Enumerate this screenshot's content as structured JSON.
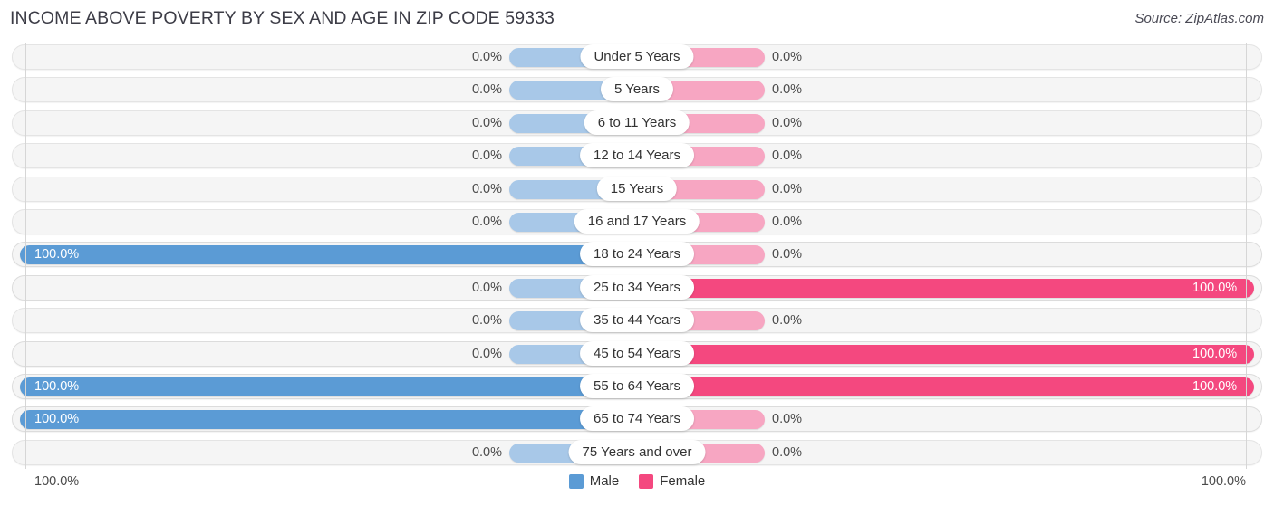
{
  "header": {
    "title": "INCOME ABOVE POVERTY BY SEX AND AGE IN ZIP CODE 59333",
    "source": "Source: ZipAtlas.com"
  },
  "legend": {
    "male_label": "Male",
    "female_label": "Female",
    "male_color": "#5b9bd5",
    "female_color": "#f4487f"
  },
  "axis": {
    "left_label": "100.0%",
    "right_label": "100.0%"
  },
  "chart_data": {
    "type": "bar",
    "title": "INCOME ABOVE POVERTY BY SEX AND AGE IN ZIP CODE 59333",
    "subtitle": "Source: ZipAtlas.com",
    "orientation": "horizontal-diverging",
    "xlabel": "",
    "ylabel": "",
    "xlim": [
      0,
      100
    ],
    "grid": false,
    "legend_position": "bottom-center",
    "categories": [
      "Under 5 Years",
      "5 Years",
      "6 to 11 Years",
      "12 to 14 Years",
      "15 Years",
      "16 and 17 Years",
      "18 to 24 Years",
      "25 to 34 Years",
      "35 to 44 Years",
      "45 to 54 Years",
      "55 to 64 Years",
      "65 to 74 Years",
      "75 Years and over"
    ],
    "series": [
      {
        "name": "Male",
        "color": "#5b9bd5",
        "values": [
          0.0,
          0.0,
          0.0,
          0.0,
          0.0,
          0.0,
          100.0,
          0.0,
          0.0,
          0.0,
          100.0,
          100.0,
          0.0
        ],
        "labels": [
          "0.0%",
          "0.0%",
          "0.0%",
          "0.0%",
          "0.0%",
          "0.0%",
          "100.0%",
          "0.0%",
          "0.0%",
          "0.0%",
          "100.0%",
          "100.0%",
          "0.0%"
        ]
      },
      {
        "name": "Female",
        "color": "#f4487f",
        "values": [
          0.0,
          0.0,
          0.0,
          0.0,
          0.0,
          0.0,
          0.0,
          100.0,
          0.0,
          100.0,
          100.0,
          0.0,
          0.0
        ],
        "labels": [
          "0.0%",
          "0.0%",
          "0.0%",
          "0.0%",
          "0.0%",
          "0.0%",
          "0.0%",
          "100.0%",
          "0.0%",
          "100.0%",
          "100.0%",
          "0.0%",
          "0.0%"
        ]
      }
    ]
  },
  "rows": [
    {
      "label": "Under 5 Years",
      "male": 0.0,
      "male_label": "0.0%",
      "female": 0.0,
      "female_label": "0.0%"
    },
    {
      "label": "5 Years",
      "male": 0.0,
      "male_label": "0.0%",
      "female": 0.0,
      "female_label": "0.0%"
    },
    {
      "label": "6 to 11 Years",
      "male": 0.0,
      "male_label": "0.0%",
      "female": 0.0,
      "female_label": "0.0%"
    },
    {
      "label": "12 to 14 Years",
      "male": 0.0,
      "male_label": "0.0%",
      "female": 0.0,
      "female_label": "0.0%"
    },
    {
      "label": "15 Years",
      "male": 0.0,
      "male_label": "0.0%",
      "female": 0.0,
      "female_label": "0.0%"
    },
    {
      "label": "16 and 17 Years",
      "male": 0.0,
      "male_label": "0.0%",
      "female": 0.0,
      "female_label": "0.0%"
    },
    {
      "label": "18 to 24 Years",
      "male": 100.0,
      "male_label": "100.0%",
      "female": 0.0,
      "female_label": "0.0%"
    },
    {
      "label": "25 to 34 Years",
      "male": 0.0,
      "male_label": "0.0%",
      "female": 100.0,
      "female_label": "100.0%"
    },
    {
      "label": "35 to 44 Years",
      "male": 0.0,
      "male_label": "0.0%",
      "female": 0.0,
      "female_label": "0.0%"
    },
    {
      "label": "45 to 54 Years",
      "male": 0.0,
      "male_label": "0.0%",
      "female": 100.0,
      "female_label": "100.0%"
    },
    {
      "label": "55 to 64 Years",
      "male": 100.0,
      "male_label": "100.0%",
      "female": 100.0,
      "female_label": "100.0%"
    },
    {
      "label": "65 to 74 Years",
      "male": 100.0,
      "male_label": "100.0%",
      "female": 0.0,
      "female_label": "0.0%"
    },
    {
      "label": "75 Years and over",
      "male": 0.0,
      "male_label": "0.0%",
      "female": 0.0,
      "female_label": "0.0%"
    }
  ]
}
